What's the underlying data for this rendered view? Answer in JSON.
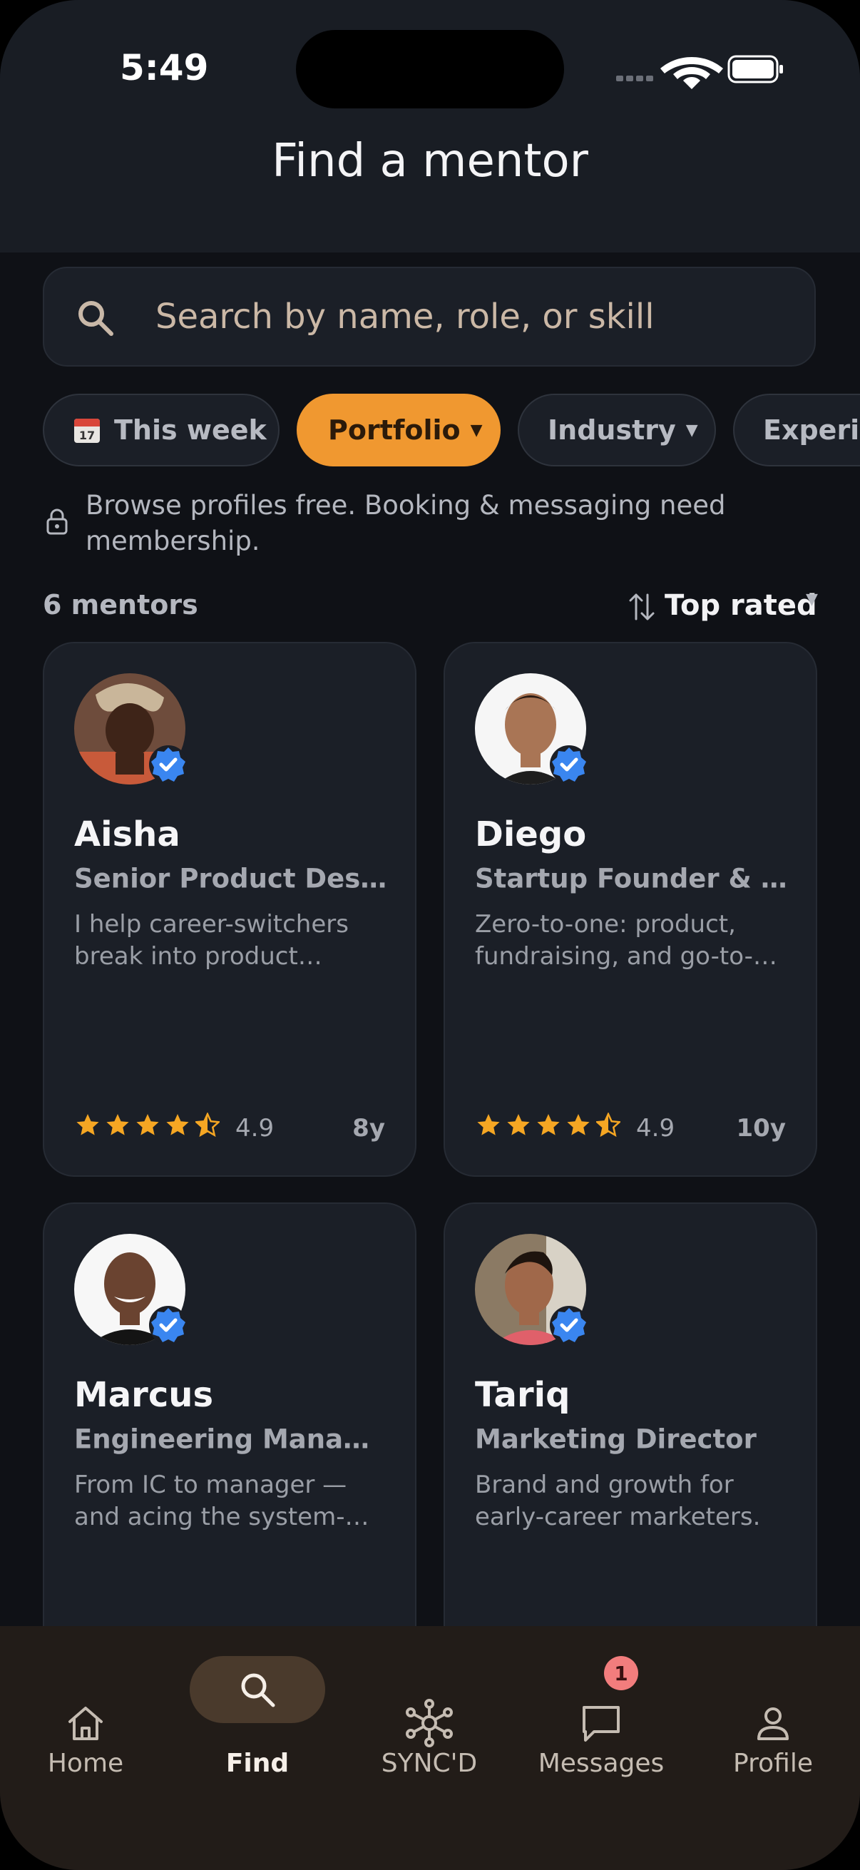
{
  "status": {
    "time": "5:49"
  },
  "header": {
    "title": "Find a mentor"
  },
  "search": {
    "placeholder": "Search by name, role, or skill"
  },
  "filters": [
    {
      "label": "This week",
      "icon": "calendar-icon"
    },
    {
      "label": "Portfolio",
      "active": true
    },
    {
      "label": "Industry"
    },
    {
      "label": "Experience"
    }
  ],
  "calendar_day": "17",
  "notice": "Browse profiles free. Booking & messaging need membership.",
  "results": {
    "count": "6 mentors",
    "sort_label": "Top rated"
  },
  "mentors": [
    {
      "name": "Aisha",
      "role": "Senior Product Designer",
      "bio": "I help career-switchers break into product design.",
      "rating": "4.9",
      "years": "8y"
    },
    {
      "name": "Diego",
      "role": "Startup Founder & PM",
      "bio": "Zero-to-one: product, fundraising, and go-to-market.",
      "rating": "4.9",
      "years": "10y"
    },
    {
      "name": "Marcus",
      "role": "Engineering Manager",
      "bio": "From IC to manager — and acing the system-design interview.",
      "rating": "",
      "years": ""
    },
    {
      "name": "Tariq",
      "role": "Marketing Director",
      "bio": "Brand and growth for early-career marketers.",
      "rating": "",
      "years": ""
    }
  ],
  "tabs": [
    {
      "label": "Home",
      "icon": "home-icon"
    },
    {
      "label": "Find",
      "icon": "search-icon",
      "active": true
    },
    {
      "label": "SYNC'D",
      "icon": "network-icon"
    },
    {
      "label": "Messages",
      "icon": "message-icon",
      "badge": "1"
    },
    {
      "label": "Profile",
      "icon": "person-icon"
    }
  ],
  "colors": {
    "accent": "#f09830",
    "verified": "#3a86f0",
    "star": "#f5a623",
    "background": "#0f1116",
    "card": "#1b1f27"
  }
}
